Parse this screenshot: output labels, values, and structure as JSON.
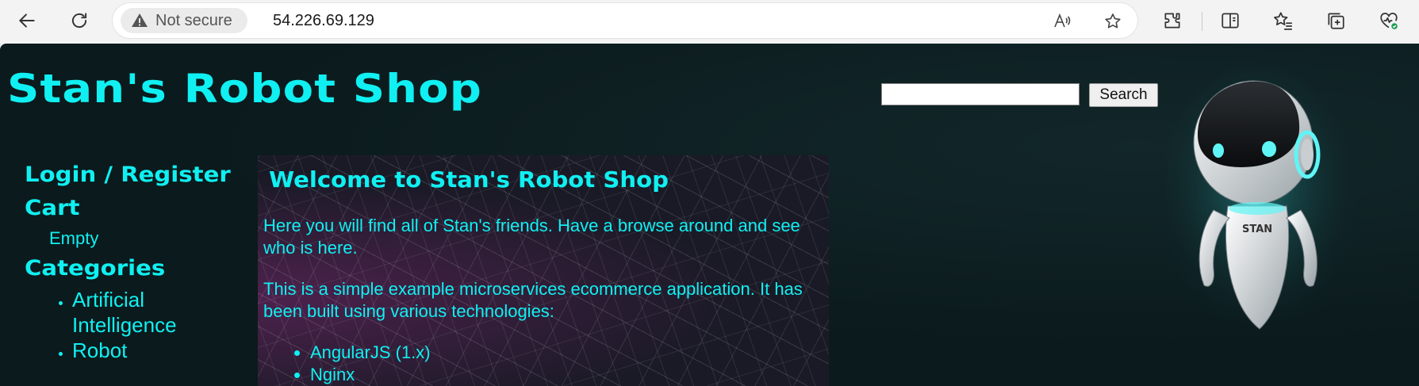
{
  "browser": {
    "security_label": "Not secure",
    "url": "54.226.69.129"
  },
  "site": {
    "title": "Stan's Robot Shop",
    "search": {
      "value": "",
      "button_label": "Search"
    }
  },
  "sidebar": {
    "login_label": "Login / Register",
    "cart_label": "Cart",
    "cart_status": "Empty",
    "categories_label": "Categories",
    "categories": [
      "Artificial Intelligence",
      "Robot"
    ]
  },
  "main": {
    "welcome_heading": "Welcome to Stan's Robot Shop",
    "paragraph_1": "Here you will find all of Stan's friends. Have a browse around and see who is here.",
    "paragraph_2": "This is a simple example microservices ecommerce application. It has been built using various technologies:",
    "technologies": [
      "AngularJS (1.x)",
      "Nginx"
    ]
  },
  "robot_badge": "STAN",
  "colors": {
    "accent": "#10f0f2",
    "page_background": "#0b1a1c",
    "chrome_background": "#f3f3f3"
  },
  "icons": [
    "back-arrow-icon",
    "refresh-icon",
    "warning-icon",
    "read-aloud-icon",
    "favorite-star-icon",
    "extensions-icon",
    "split-screen-icon",
    "favorites-icon",
    "collections-icon",
    "browser-essentials-icon"
  ]
}
